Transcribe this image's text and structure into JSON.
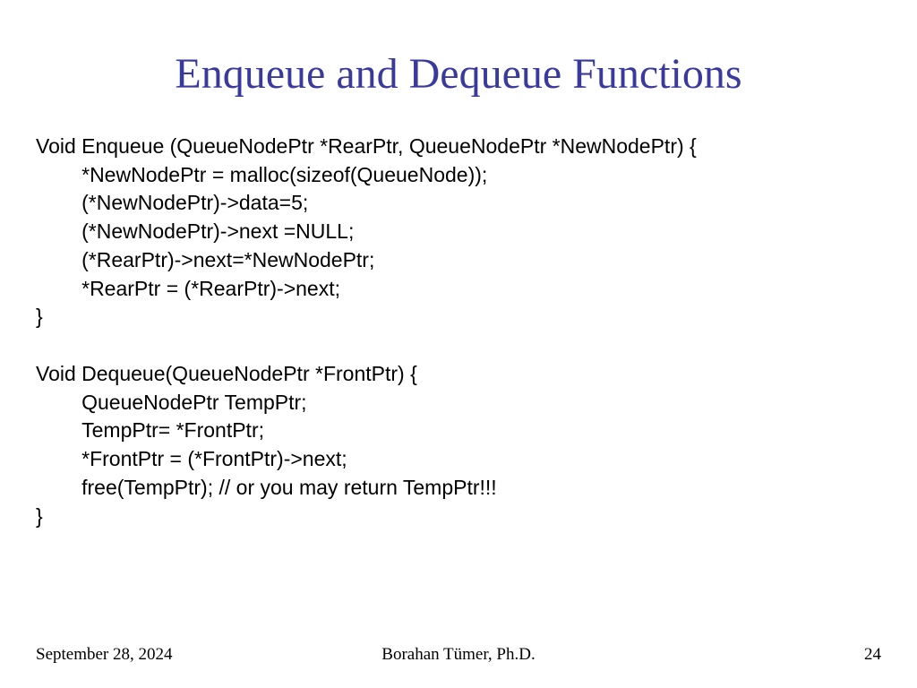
{
  "slide": {
    "title": "Enqueue and Dequeue Functions",
    "code": "Void Enqueue (QueueNodePtr *RearPtr, QueueNodePtr *NewNodePtr) {\n\t*NewNodePtr = malloc(sizeof(QueueNode));\n\t(*NewNodePtr)->data=5;\n\t(*NewNodePtr)->next =NULL;\n\t(*RearPtr)->next=*NewNodePtr;\n\t*RearPtr = (*RearPtr)->next;\n}\n\nVoid Dequeue(QueueNodePtr *FrontPtr) {\n\tQueueNodePtr TempPtr;\n\tTempPtr= *FrontPtr;\n\t*FrontPtr = (*FrontPtr)->next;\n\tfree(TempPtr); // or you may return TempPtr!!!\n}"
  },
  "footer": {
    "date": "September 28, 2024",
    "author": "Borahan Tümer, Ph.D.",
    "page": "24"
  }
}
